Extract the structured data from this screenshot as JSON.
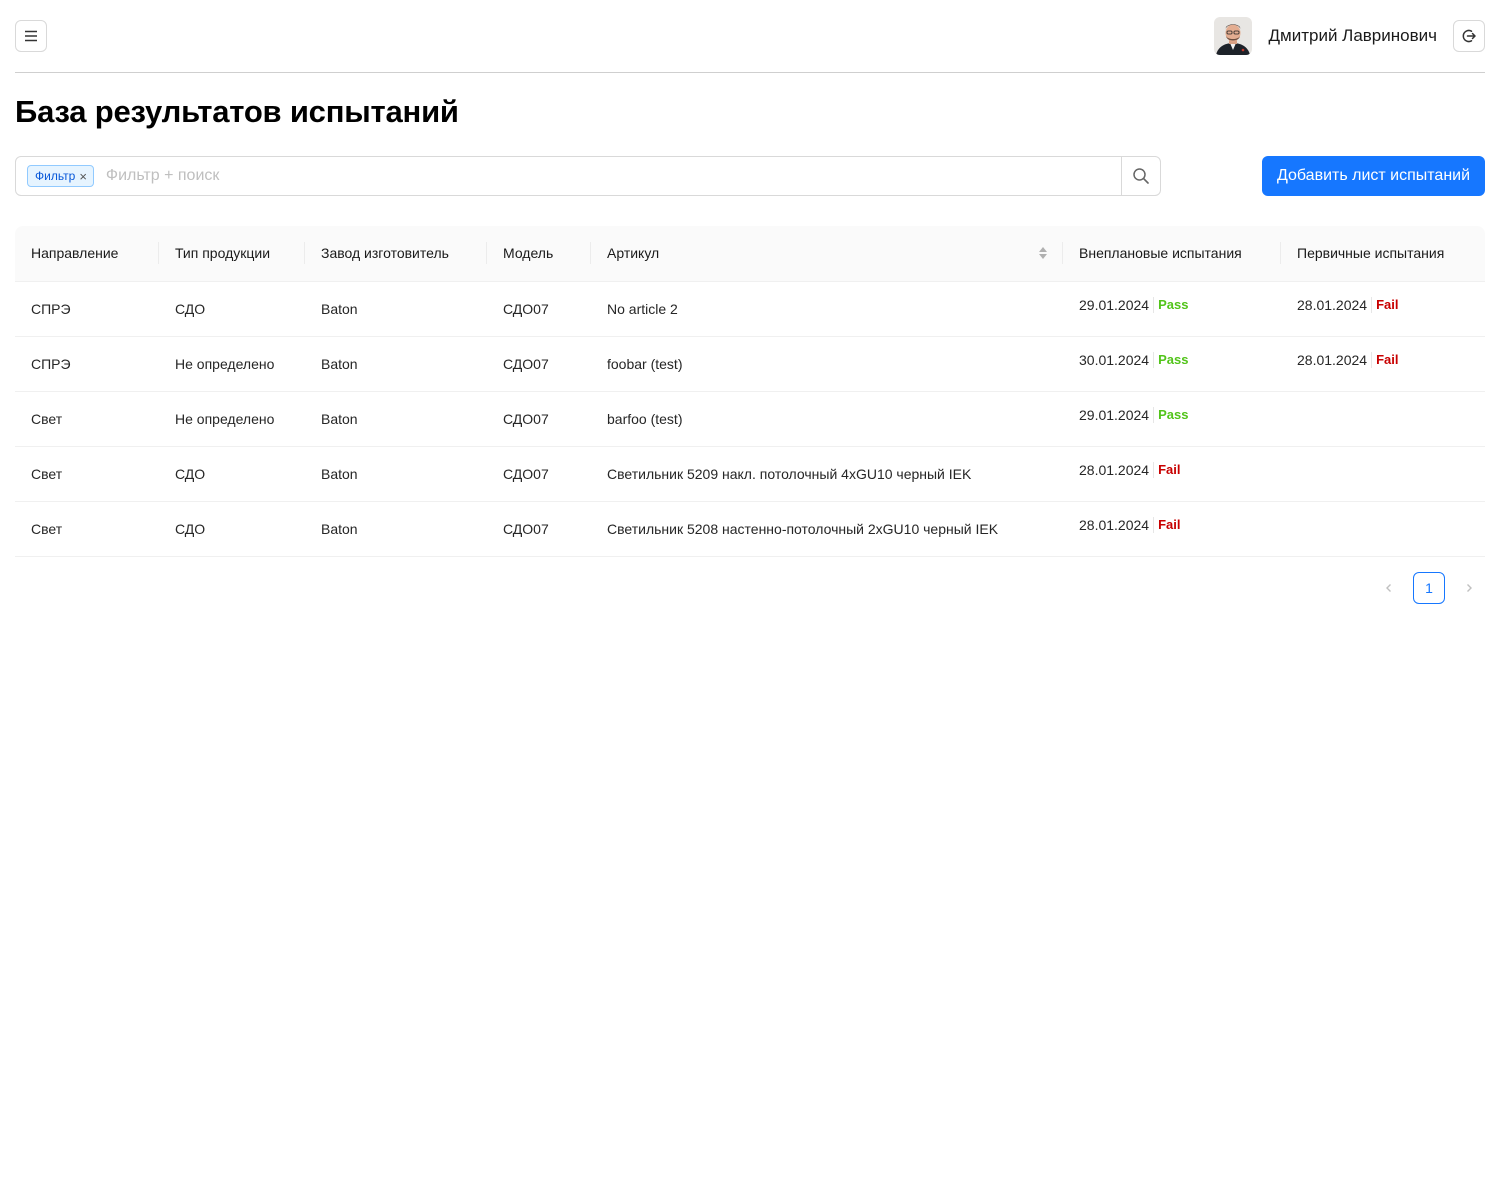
{
  "header": {
    "user_name": "Дмитрий Лавринович",
    "menu_icon": "hamburger-menu-icon",
    "logout_icon": "logout-icon"
  },
  "page": {
    "title": "База результатов испытаний"
  },
  "search": {
    "filter_tag": "Фильтр",
    "placeholder": "Фильтр + поиск",
    "value": ""
  },
  "actions": {
    "add_label": "Добавить лист испытаний"
  },
  "colors": {
    "primary": "#1677ff",
    "pass": "#52c41a",
    "fail": "#c80000"
  },
  "table": {
    "columns": [
      "Направление",
      "Тип продукции",
      "Завод изготовитель",
      "Модель",
      "Артикул",
      "Внеплановые испытания",
      "Первичные испытания"
    ],
    "rows": [
      {
        "direction": "СПРЭ",
        "product_type": "СДО",
        "factory": "Baton",
        "model": "СДО07",
        "article": "No article 2",
        "unplanned": {
          "date": "29.01.2024",
          "status": "Pass"
        },
        "primary": {
          "date": "28.01.2024",
          "status": "Fail"
        }
      },
      {
        "direction": "СПРЭ",
        "product_type": "Не определено",
        "factory": "Baton",
        "model": "СДО07",
        "article": "foobar (test)",
        "unplanned": {
          "date": "30.01.2024",
          "status": "Pass"
        },
        "primary": {
          "date": "28.01.2024",
          "status": "Fail"
        }
      },
      {
        "direction": "Свет",
        "product_type": "Не определено",
        "factory": "Baton",
        "model": "СДО07",
        "article": "barfoo (test)",
        "unplanned": {
          "date": "29.01.2024",
          "status": "Pass"
        },
        "primary": null
      },
      {
        "direction": "Свет",
        "product_type": "СДО",
        "factory": "Baton",
        "model": "СДО07",
        "article": "Светильник 5209 накл. потолочный 4xGU10 черный IEK",
        "unplanned": {
          "date": "28.01.2024",
          "status": "Fail"
        },
        "primary": null
      },
      {
        "direction": "Свет",
        "product_type": "СДО",
        "factory": "Baton",
        "model": "СДО07",
        "article": "Светильник 5208 настенно-потолочный 2xGU10 черный IEK",
        "unplanned": {
          "date": "28.01.2024",
          "status": "Fail"
        },
        "primary": null
      }
    ]
  },
  "pagination": {
    "current_page": "1"
  }
}
